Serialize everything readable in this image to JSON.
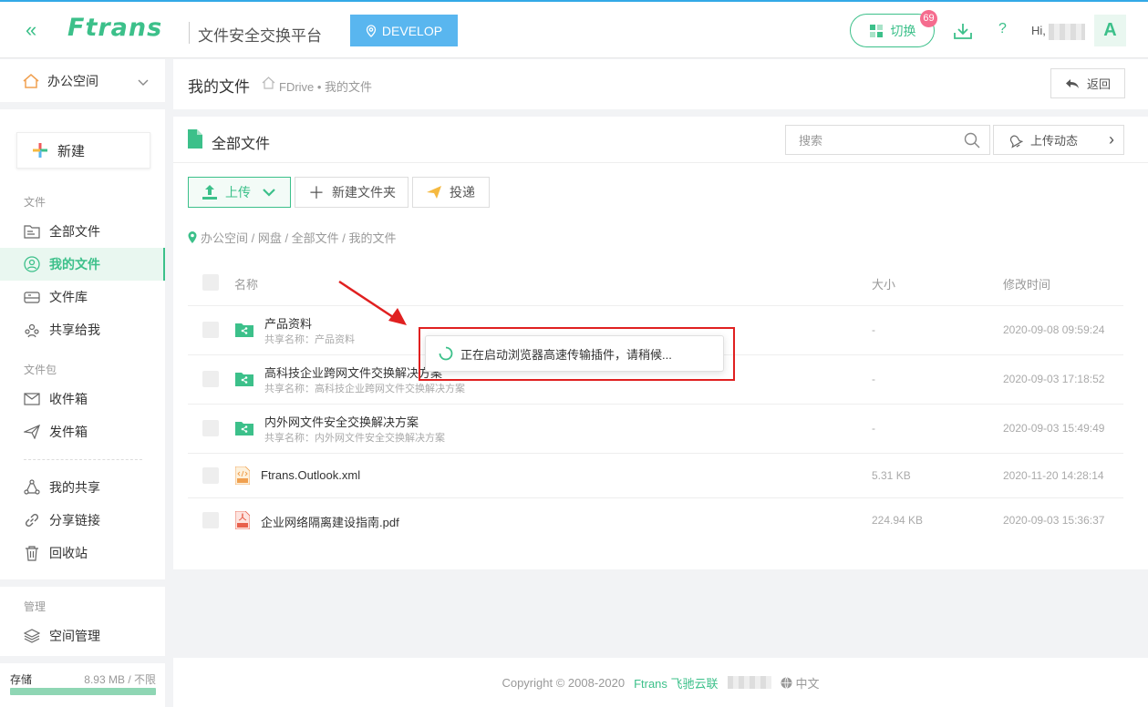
{
  "header": {
    "logo": "Ftrans",
    "platform": "文件安全交换平台",
    "env": "DEVELOP",
    "switch_label": "切换",
    "switch_badge": "69",
    "help": "?",
    "greeting": "Hi,",
    "avatar": "A"
  },
  "sidebar": {
    "space": "办公空间",
    "new_label": "新建",
    "section_files": "文件",
    "files": [
      {
        "label": "全部文件",
        "icon": "folder-icon"
      },
      {
        "label": "我的文件",
        "icon": "user-icon"
      },
      {
        "label": "文件库",
        "icon": "database-icon"
      },
      {
        "label": "共享给我",
        "icon": "shared-icon"
      }
    ],
    "section_packages": "文件包",
    "packages": [
      {
        "label": "收件箱",
        "icon": "mail-icon"
      },
      {
        "label": "发件箱",
        "icon": "send-icon"
      }
    ],
    "others": [
      {
        "label": "我的共享",
        "icon": "share-icon"
      },
      {
        "label": "分享链接",
        "icon": "link-icon"
      },
      {
        "label": "回收站",
        "icon": "trash-icon"
      }
    ],
    "section_manage": "管理",
    "manage": [
      {
        "label": "空间管理",
        "icon": "layers-icon"
      }
    ],
    "storage_label": "存储",
    "storage_value": "8.93 MB / 不限"
  },
  "crumbbar": {
    "title": "我的文件",
    "path": "FDrive • 我的文件",
    "back_label": "返回"
  },
  "main": {
    "title": "全部文件",
    "search_placeholder": "搜索",
    "upload_feed_label": "上传动态",
    "upload_label": "上传",
    "new_folder_label": "新建文件夹",
    "deliver_label": "投递",
    "location": "办公空间 / 网盘 / 全部文件 / 我的文件",
    "columns": {
      "name": "名称",
      "size": "大小",
      "time": "修改时间"
    },
    "rows": [
      {
        "name": "产品资料",
        "share": "共享名称：产品资料",
        "size": "-",
        "time": "2020-09-08 09:59:24",
        "type": "folder"
      },
      {
        "name": "高科技企业跨网文件交换解决方案",
        "share": "共享名称：高科技企业跨网文件交换解决方案",
        "size": "-",
        "time": "2020-09-03 17:18:52",
        "type": "folder"
      },
      {
        "name": "内外网文件安全交换解决方案",
        "share": "共享名称：内外网文件安全交换解决方案",
        "size": "-",
        "time": "2020-09-03 15:49:49",
        "type": "folder"
      },
      {
        "name": "Ftrans.Outlook.xml",
        "share": "",
        "size": "5.31 KB",
        "time": "2020-11-20 14:28:14",
        "type": "xml"
      },
      {
        "name": "企业网络隔离建设指南.pdf",
        "share": "",
        "size": "224.94 KB",
        "time": "2020-09-03 15:36:37",
        "type": "pdf"
      }
    ]
  },
  "toast": {
    "message": "正在启动浏览器高速传输插件，请稍候..."
  },
  "footer": {
    "copyright": "Copyright © 2008-2020",
    "brand": "Ftrans 飞驰云联",
    "language": "中文"
  },
  "colors": {
    "accent": "#3cc08a",
    "develop": "#59b6ef",
    "badge": "#f56c8e",
    "highlight": "#e02020"
  }
}
